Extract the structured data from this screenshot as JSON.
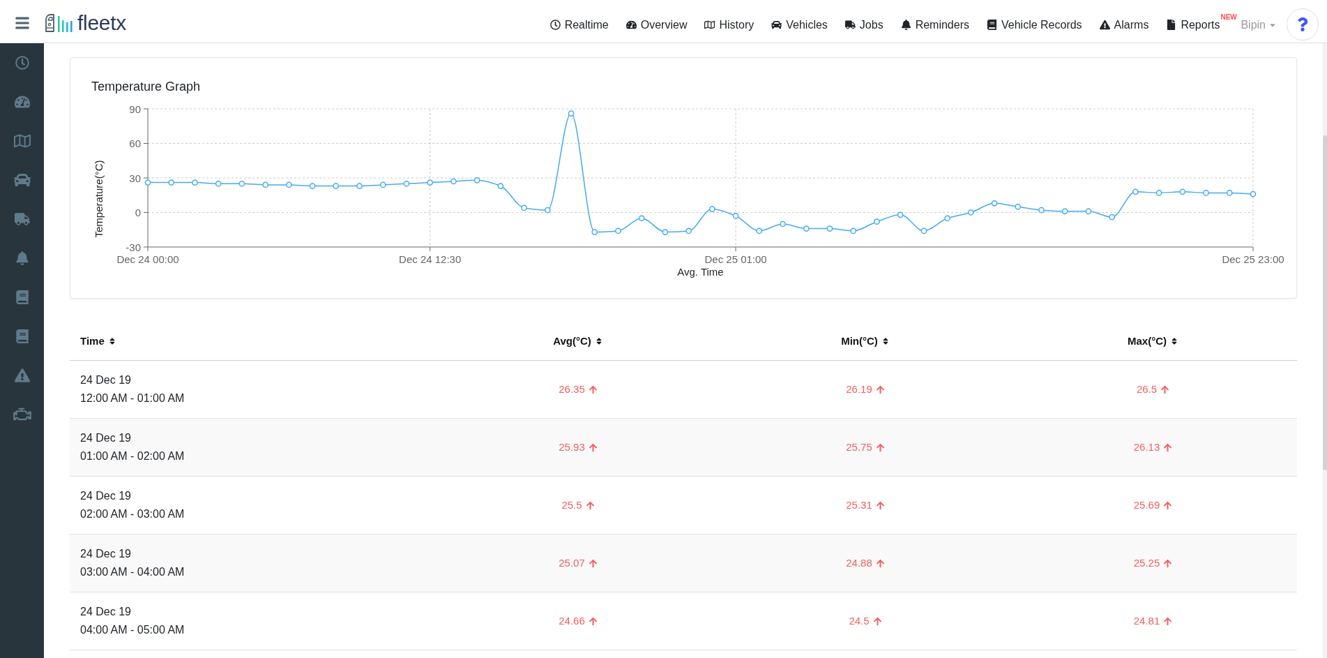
{
  "header": {
    "logo_text": "fleetx",
    "nav": [
      {
        "label": "Realtime"
      },
      {
        "label": "Overview"
      },
      {
        "label": "History"
      },
      {
        "label": "Vehicles"
      },
      {
        "label": "Jobs"
      },
      {
        "label": "Reminders"
      },
      {
        "label": "Vehicle Records"
      },
      {
        "label": "Alarms"
      },
      {
        "label": "Reports",
        "badge": "NEW"
      }
    ],
    "user": "Bipin"
  },
  "chart": {
    "title": "Temperature Graph",
    "chart_data": {
      "type": "line",
      "xlabel": "Avg. Time",
      "ylabel": "Temperature(°C)",
      "categories": [
        "Dec 24 00:00",
        null,
        null,
        null,
        null,
        null,
        null,
        null,
        null,
        null,
        null,
        null,
        "Dec 24 12:30",
        null,
        null,
        null,
        null,
        null,
        null,
        null,
        null,
        null,
        null,
        null,
        null,
        "Dec 25 01:00",
        null,
        null,
        null,
        null,
        null,
        null,
        null,
        null,
        null,
        null,
        null,
        null,
        null,
        null,
        null,
        null,
        null,
        null,
        null,
        null,
        null,
        "Dec 25 23:00"
      ],
      "values": [
        26,
        26,
        26,
        25,
        25,
        24,
        24,
        23,
        23,
        23,
        24,
        25,
        26,
        27,
        28,
        23,
        4,
        2,
        86,
        -17,
        -16,
        -5,
        -17,
        -16,
        3,
        -3,
        -16,
        -10,
        -14,
        -14,
        -16,
        -8,
        -2,
        -16,
        -5,
        0,
        8,
        5,
        2,
        1,
        1,
        -4,
        18,
        17,
        18,
        17,
        17,
        16
      ],
      "ylim": [
        -30,
        90
      ],
      "yticks": [
        -30,
        0,
        30,
        60,
        90
      ],
      "grid": true,
      "marker": "o"
    }
  },
  "table": {
    "columns": [
      {
        "label": "Time"
      },
      {
        "label": "Avg(°C)"
      },
      {
        "label": "Min(°C)"
      },
      {
        "label": "Max(°C)"
      }
    ],
    "rows": [
      {
        "date": "24 Dec 19",
        "period": "12:00 AM - 01:00 AM",
        "values": [
          {
            "value": "26.35",
            "rising": true
          },
          {
            "value": "26.19",
            "rising": true
          },
          {
            "value": "26.5",
            "rising": true
          }
        ]
      },
      {
        "date": "24 Dec 19",
        "period": "01:00 AM - 02:00 AM",
        "values": [
          {
            "value": "25.93",
            "rising": true
          },
          {
            "value": "25.75",
            "rising": true
          },
          {
            "value": "26.13",
            "rising": true
          }
        ]
      },
      {
        "date": "24 Dec 19",
        "period": "02:00 AM - 03:00 AM",
        "values": [
          {
            "value": "25.5",
            "rising": true
          },
          {
            "value": "25.31",
            "rising": true
          },
          {
            "value": "25.69",
            "rising": true
          }
        ]
      },
      {
        "date": "24 Dec 19",
        "period": "03:00 AM - 04:00 AM",
        "values": [
          {
            "value": "25.07",
            "rising": true
          },
          {
            "value": "24.88",
            "rising": true
          },
          {
            "value": "25.25",
            "rising": true
          }
        ]
      },
      {
        "date": "24 Dec 19",
        "period": "04:00 AM - 05:00 AM",
        "values": [
          {
            "value": "24.66",
            "rising": true
          },
          {
            "value": "24.5",
            "rising": true
          },
          {
            "value": "24.81",
            "rising": true
          }
        ]
      }
    ]
  }
}
